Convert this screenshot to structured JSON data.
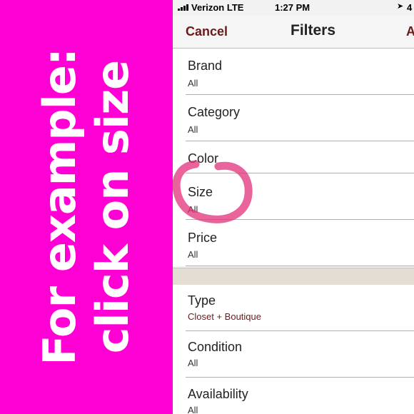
{
  "banner": {
    "line1": "For example:",
    "line2": "click on size",
    "color": "#ff00d4"
  },
  "status_bar": {
    "carrier": "Verizon LTE",
    "time": "1:27 PM",
    "location_icon": "location-arrow-icon",
    "battery_text": "4"
  },
  "nav": {
    "cancel_label": "Cancel",
    "title": "Filters",
    "apply_label": "A"
  },
  "filters_top": [
    {
      "label": "Brand",
      "value": "All"
    },
    {
      "label": "Category",
      "value": "All"
    },
    {
      "label": "Color",
      "value": ""
    },
    {
      "label": "Size",
      "value": "All"
    },
    {
      "label": "Price",
      "value": "All"
    }
  ],
  "filters_bottom": [
    {
      "label": "Type",
      "value": "Closet + Boutique"
    },
    {
      "label": "Condition",
      "value": "All"
    },
    {
      "label": "Availability",
      "value": "All"
    }
  ],
  "colors": {
    "accent": "#6b1a1a",
    "annotation": "#e0307a"
  }
}
